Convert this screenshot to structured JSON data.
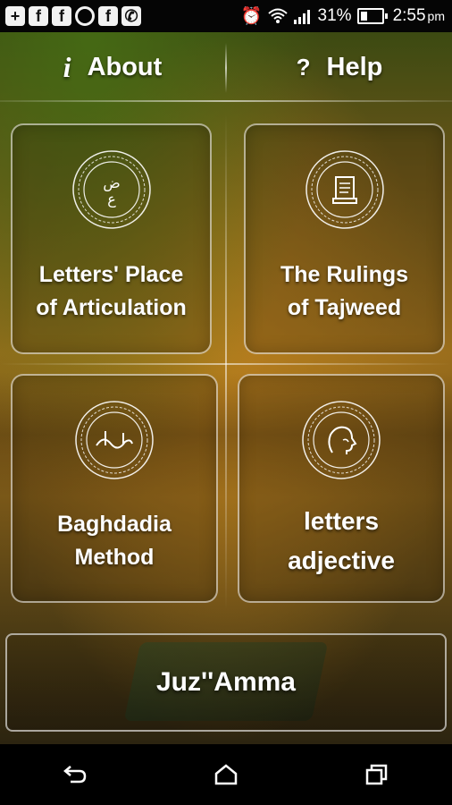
{
  "status_bar": {
    "notification_icons": [
      "plus-icon",
      "facebook-icon",
      "facebook-icon",
      "sync-icon",
      "facebook-icon",
      "viber-icon"
    ],
    "battery": "31%",
    "time": "2:55",
    "time_suffix": "pm"
  },
  "topbar": {
    "about_icon": "i",
    "about_label": "About",
    "help_icon": "?",
    "help_label": "Help"
  },
  "cards": [
    {
      "label": "Letters' Place\nof Articulation",
      "icon": "arabic-letters-icon"
    },
    {
      "label": "The Rulings\nof Tajweed",
      "icon": "scroll-icon"
    },
    {
      "label": "Baghdadia\nMethod",
      "icon": "calligraphy-icon"
    },
    {
      "label": "letters\nadjective",
      "icon": "head-profile-icon"
    }
  ],
  "bottom_button": {
    "label": "Juz''Amma"
  },
  "nav": [
    "back-icon",
    "home-icon",
    "recents-icon"
  ]
}
